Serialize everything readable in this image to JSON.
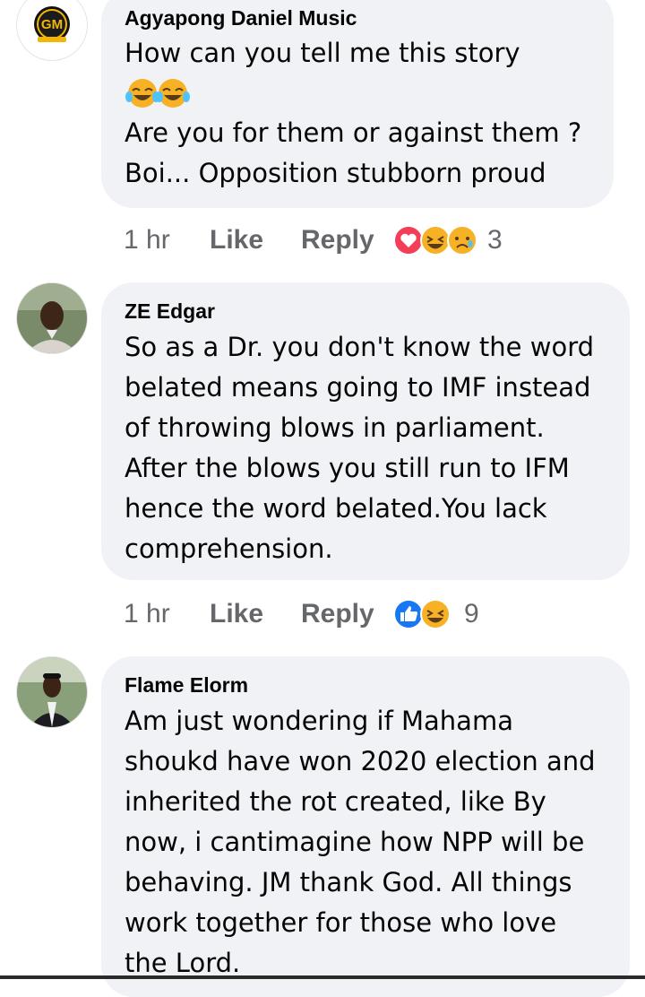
{
  "comments": [
    {
      "author": "Agyapong Daniel Music",
      "avatar_text": "GM",
      "lines": [
        "How can you tell me this story",
        "",
        "Are you for them or against them ?",
        "Boi... Opposition stubborn proud"
      ],
      "inline_emoji": [
        "laughing-tears-emoji",
        "laughing-tears-emoji"
      ],
      "time": "1 hr",
      "like_label": "Like",
      "reply_label": "Reply",
      "reactions": [
        "love",
        "haha",
        "sad"
      ],
      "reaction_count": "3"
    },
    {
      "author": "ZE Edgar",
      "lines": [
        "So as a Dr. you don't know the word",
        "belated means going to IMF instead",
        "of throwing blows in parliament.",
        "After the blows you still run to IFM",
        "hence the word belated.You lack",
        "comprehension."
      ],
      "time": "1 hr",
      "like_label": "Like",
      "reply_label": "Reply",
      "reactions": [
        "like",
        "haha"
      ],
      "reaction_count": "9"
    },
    {
      "author": "Flame Elorm",
      "lines": [
        "Am just wondering if Mahama",
        "shoukd have won 2020 election and",
        "inherited the rot created, like By",
        "now, i cantimagine how NPP will be",
        "behaving. JM thank God. All things",
        "work together for those who love",
        "the Lord."
      ]
    }
  ],
  "colors": {
    "bubble": "#f0f2f5",
    "meta_text": "#65676b",
    "like_blue": "#1877f2",
    "love_red": "#f33e58",
    "emoji_yellow": "#f7b125"
  }
}
